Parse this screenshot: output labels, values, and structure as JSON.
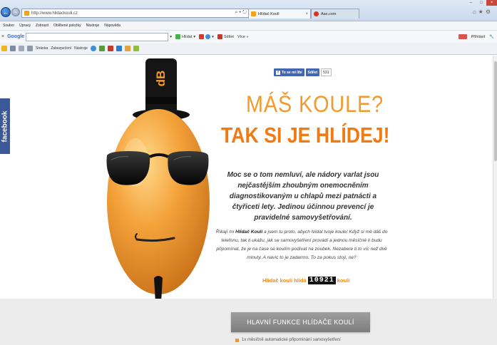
{
  "browser": {
    "url": "http://www.hlidackouli.cz",
    "tabs": [
      {
        "label": "Hlídač Koulí",
        "favicon_color": "#f3a21f",
        "active": true
      },
      {
        "label": "Aax.com",
        "favicon_color": "#d9301f",
        "active": false
      }
    ],
    "menu": [
      "Soubor",
      "Úpravy",
      "Zobrazit",
      "Oblíbené položky",
      "Nástroje",
      "Nápověda"
    ],
    "google_bar": {
      "logo": "Google",
      "hlidat_label": "Hlídat",
      "sdilet_label": "Sdílet",
      "vice_label": "Více »",
      "prihlasit_label": "Přihlásit"
    },
    "command_bar": [
      "Stránka",
      "Zabezpečení",
      "Nástroje"
    ]
  },
  "page": {
    "facebook_tab": "facebook",
    "share_label": "To se mi líbí",
    "like_label": "Sdílet",
    "like_count": "531",
    "headline_question": "MÁŠ KOULE?",
    "headline_answer": "TAK SI JE HLÍDEJ!",
    "intro": "Moc se o tom nemluví, ale nádory varlat jsou nejčastějším zhoubným onemocněním diagnostikovaným u chlapů mezi patnácti a čtyřiceti lety. Jedinou účinnou prevencí je pravidelné samovyšetřování.",
    "body_prefix": "Říkají mi ",
    "body_name": "Hlídač Koulí",
    "body_rest": " a jsem tu proto, abych hlídal tvoje koule! Když si mě dáš do telefonu, tak ti ukážu, jak se samovyšetření provádí a jednou měsíčně ti budu připomínat, že je na čase se koulím podívat na zoubek. Nezabere ti to víc než dvě minuty. A navíc to je zadarmo. To za pokus stojí, ne?",
    "counter_prefix": "Hlídač koulí hlídá",
    "counter_value": "10921",
    "counter_suffix": "koulí",
    "functions_button": "HLAVNÍ FUNKCE HLÍDAČE KOULÍ",
    "function_item": "1x měsíčně automatické připomínání samovyšetření"
  },
  "colors": {
    "accent_orange": "#f27a12",
    "headline_light": "#f29a2e",
    "facebook_blue": "#3b5998"
  }
}
